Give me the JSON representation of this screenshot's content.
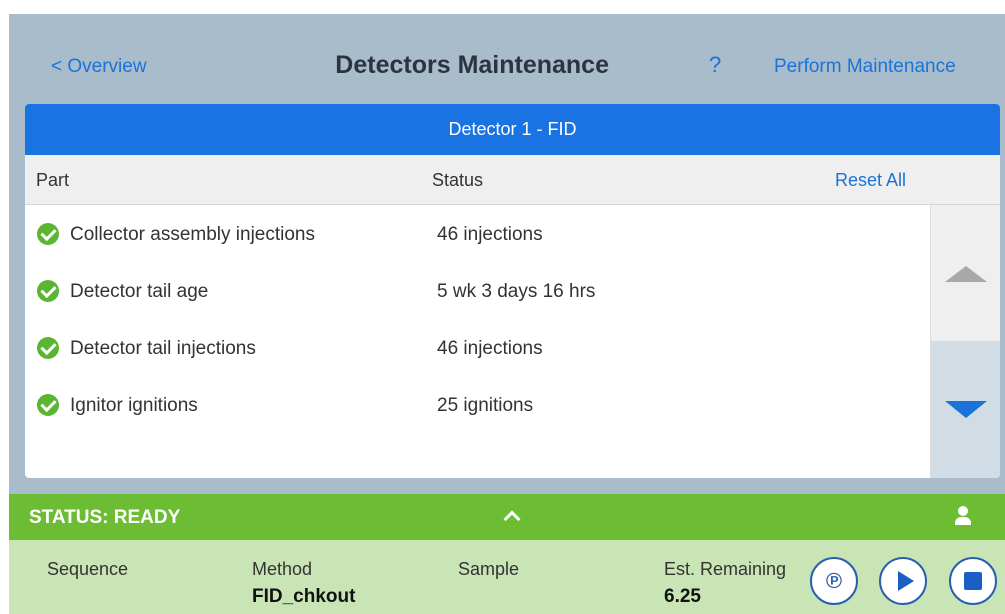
{
  "header": {
    "back_label": "< Overview",
    "title": "Detectors Maintenance",
    "help_label": "?",
    "perform_label": "Perform Maintenance"
  },
  "card": {
    "title": "Detector 1 - FID",
    "columns": {
      "part": "Part",
      "status": "Status",
      "reset_all": "Reset All"
    },
    "rows": [
      {
        "part": "Collector assembly injections",
        "status": "46 injections",
        "state": "ok"
      },
      {
        "part": "Detector tail age",
        "status": "5 wk 3 days 16 hrs",
        "state": "ok"
      },
      {
        "part": "Detector tail injections",
        "status": "46 injections",
        "state": "ok"
      },
      {
        "part": "Ignitor ignitions",
        "status": "25 ignitions",
        "state": "ok"
      }
    ]
  },
  "status_bar": {
    "text": "STATUS: READY"
  },
  "info": {
    "sequence_label": "Sequence",
    "sequence_value": "",
    "method_label": "Method",
    "method_value": "FID_chkout",
    "sample_label": "Sample",
    "sample_value": "",
    "remaining_label": "Est. Remaining",
    "remaining_value": "6.25"
  },
  "colors": {
    "accent_blue": "#1a73e2",
    "header_bg": "#a9bccb",
    "status_green": "#6cbd33",
    "info_bg": "#c9e4b5",
    "check_green": "#5cb531"
  }
}
